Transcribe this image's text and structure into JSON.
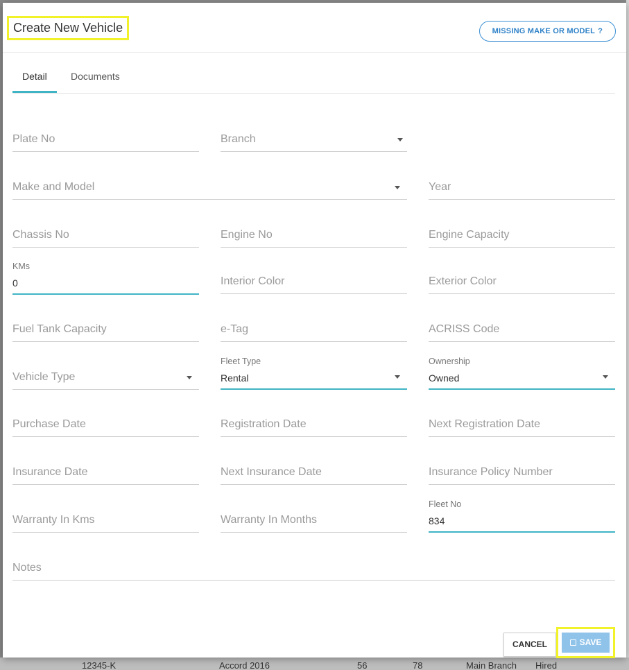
{
  "dialog": {
    "title": "Create New Vehicle",
    "missing_button": "MISSING MAKE OR MODEL",
    "missing_button_icon": "?",
    "tabs": [
      {
        "label": "Detail",
        "active": true
      },
      {
        "label": "Documents",
        "active": false
      }
    ]
  },
  "fields": {
    "plate_no": {
      "placeholder": "Plate No"
    },
    "branch": {
      "placeholder": "Branch"
    },
    "make_model": {
      "placeholder": "Make and Model"
    },
    "year": {
      "placeholder": "Year"
    },
    "chassis_no": {
      "placeholder": "Chassis No"
    },
    "engine_no": {
      "placeholder": "Engine No"
    },
    "engine_capacity": {
      "placeholder": "Engine Capacity"
    },
    "kms": {
      "label": "KMs",
      "value": "0"
    },
    "interior_color": {
      "placeholder": "Interior Color"
    },
    "exterior_color": {
      "placeholder": "Exterior Color"
    },
    "fuel_tank_capacity": {
      "placeholder": "Fuel Tank Capacity"
    },
    "etag": {
      "placeholder": "e-Tag"
    },
    "acriss_code": {
      "placeholder": "ACRISS Code"
    },
    "vehicle_type": {
      "placeholder": "Vehicle Type"
    },
    "fleet_type": {
      "label": "Fleet Type",
      "value": "Rental"
    },
    "ownership": {
      "label": "Ownership",
      "value": "Owned"
    },
    "purchase_date": {
      "placeholder": "Purchase Date"
    },
    "registration_date": {
      "placeholder": "Registration Date"
    },
    "next_registration_date": {
      "placeholder": "Next Registration Date"
    },
    "insurance_date": {
      "placeholder": "Insurance Date"
    },
    "next_insurance_date": {
      "placeholder": "Next Insurance Date"
    },
    "insurance_policy_number": {
      "placeholder": "Insurance Policy Number"
    },
    "warranty_kms": {
      "placeholder": "Warranty In Kms"
    },
    "warranty_months": {
      "placeholder": "Warranty In Months"
    },
    "fleet_no": {
      "label": "Fleet No",
      "value": "834"
    },
    "notes": {
      "placeholder": "Notes"
    }
  },
  "footer": {
    "cancel_label": "CANCEL",
    "save_label": "SAVE"
  },
  "background": {
    "row_cells": [
      "12345-K",
      "Accord 2016",
      "56",
      "78",
      "Main Branch",
      "Hired"
    ]
  },
  "colors": {
    "accent": "#3fb4c4",
    "link_blue": "#2f82c8",
    "save_bg": "#8fc3ea",
    "highlight": "#f2f22b"
  }
}
